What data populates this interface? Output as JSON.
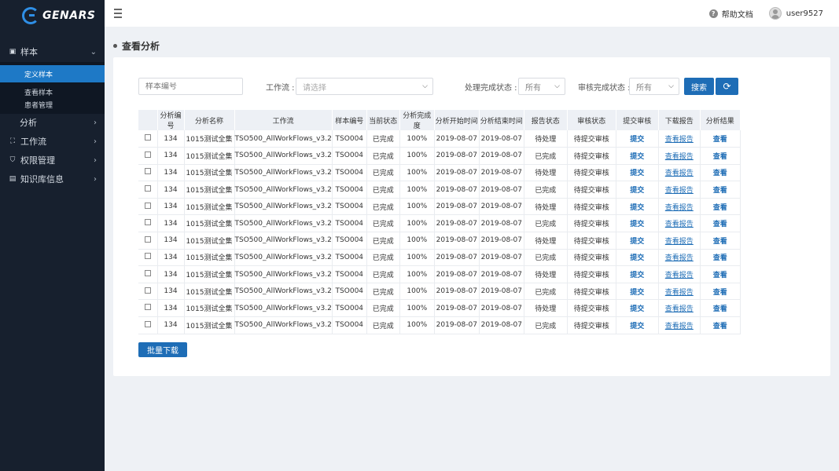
{
  "brand": {
    "name": "GENARS"
  },
  "sidebar": {
    "groups": [
      {
        "label": "样本",
        "icon": "calendar-icon"
      },
      {
        "label": "分析",
        "icon": ""
      },
      {
        "label": "工作流",
        "icon": "workflow-icon"
      },
      {
        "label": "权限管理",
        "icon": "shield-icon"
      },
      {
        "label": "知识库信息",
        "icon": "book-icon"
      }
    ],
    "sample_sub": [
      "定义样本",
      "查看样本",
      "患者管理"
    ]
  },
  "header": {
    "help_label": "帮助文档",
    "username": "user9527"
  },
  "page": {
    "title": "查看分析"
  },
  "filters": {
    "sample_placeholder": "样本编号",
    "workflow_label": "工作流 :",
    "workflow_placeholder": "请选择",
    "process_label": "处理完成状态 :",
    "process_value": "所有",
    "review_label": "审核完成状态 :",
    "review_value": "所有",
    "search_label": "搜索",
    "refresh_icon": "refresh-icon"
  },
  "table": {
    "headers": [
      "分析编号",
      "分析名称",
      "工作流",
      "样本编号",
      "当前状态",
      "分析完成度",
      "分析开始时间",
      "分析结束时间",
      "报告状态",
      "审核状态",
      "提交审核",
      "下载报告",
      "分析结果"
    ],
    "rows": [
      [
        "134",
        "1015测试全集",
        "TSO500_AllWorkFlows_v3.2",
        "TSO004",
        "已完成",
        "100%",
        "2019-08-07",
        "2019-08-07",
        "待处理",
        "待提交审核",
        "提交",
        "查看报告",
        "查看"
      ],
      [
        "134",
        "1015测试全集",
        "TSO500_AllWorkFlows_v3.2",
        "TSO004",
        "已完成",
        "100%",
        "2019-08-07",
        "2019-08-07",
        "已完成",
        "待提交审核",
        "提交",
        "查看报告",
        "查看"
      ],
      [
        "134",
        "1015测试全集",
        "TSO500_AllWorkFlows_v3.2",
        "TSO004",
        "已完成",
        "100%",
        "2019-08-07",
        "2019-08-07",
        "待处理",
        "待提交审核",
        "提交",
        "查看报告",
        "查看"
      ],
      [
        "134",
        "1015测试全集",
        "TSO500_AllWorkFlows_v3.2",
        "TSO004",
        "已完成",
        "100%",
        "2019-08-07",
        "2019-08-07",
        "已完成",
        "待提交审核",
        "提交",
        "查看报告",
        "查看"
      ],
      [
        "134",
        "1015测试全集",
        "TSO500_AllWorkFlows_v3.2",
        "TSO004",
        "已完成",
        "100%",
        "2019-08-07",
        "2019-08-07",
        "待处理",
        "待提交审核",
        "提交",
        "查看报告",
        "查看"
      ],
      [
        "134",
        "1015测试全集",
        "TSO500_AllWorkFlows_v3.2",
        "TSO004",
        "已完成",
        "100%",
        "2019-08-07",
        "2019-08-07",
        "已完成",
        "待提交审核",
        "提交",
        "查看报告",
        "查看"
      ],
      [
        "134",
        "1015测试全集",
        "TSO500_AllWorkFlows_v3.2",
        "TSO004",
        "已完成",
        "100%",
        "2019-08-07",
        "2019-08-07",
        "待处理",
        "待提交审核",
        "提交",
        "查看报告",
        "查看"
      ],
      [
        "134",
        "1015测试全集",
        "TSO500_AllWorkFlows_v3.2",
        "TSO004",
        "已完成",
        "100%",
        "2019-08-07",
        "2019-08-07",
        "已完成",
        "待提交审核",
        "提交",
        "查看报告",
        "查看"
      ],
      [
        "134",
        "1015测试全集",
        "TSO500_AllWorkFlows_v3.2",
        "TSO004",
        "已完成",
        "100%",
        "2019-08-07",
        "2019-08-07",
        "待处理",
        "待提交审核",
        "提交",
        "查看报告",
        "查看"
      ],
      [
        "134",
        "1015测试全集",
        "TSO500_AllWorkFlows_v3.2",
        "TSO004",
        "已完成",
        "100%",
        "2019-08-07",
        "2019-08-07",
        "已完成",
        "待提交审核",
        "提交",
        "查看报告",
        "查看"
      ],
      [
        "134",
        "1015测试全集",
        "TSO500_AllWorkFlows_v3.2",
        "TSO004",
        "已完成",
        "100%",
        "2019-08-07",
        "2019-08-07",
        "待处理",
        "待提交审核",
        "提交",
        "查看报告",
        "查看"
      ],
      [
        "134",
        "1015测试全集",
        "TSO500_AllWorkFlows_v3.2",
        "TSO004",
        "已完成",
        "100%",
        "2019-08-07",
        "2019-08-07",
        "已完成",
        "待提交审核",
        "提交",
        "查看报告",
        "查看"
      ]
    ]
  },
  "bulk_download_label": "批量下载",
  "colors": {
    "primary": "#1e6db6",
    "sidebar_bg": "#17202e",
    "active_nav": "#1e79c6"
  }
}
